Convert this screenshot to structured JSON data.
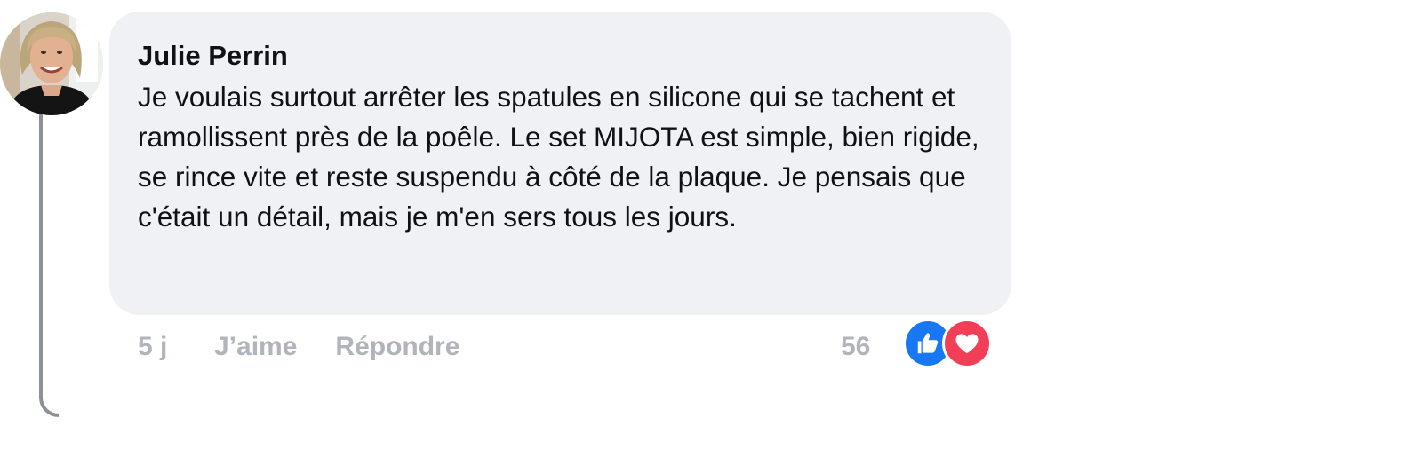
{
  "comment": {
    "author": "Julie Perrin",
    "text": "Je voulais surtout arrêter les spatules en silicone qui se tachent et ramollissent près de la poêle. Le set MIJOTA est simple, bien rigide, se rince vite et reste suspendu à côté de la plaque. Je pensais que c'était un détail, mais je m'en sers tous les jours."
  },
  "actions": {
    "time": "5 j",
    "like_label": "J’aime",
    "reply_label": "Répondre"
  },
  "reactions": {
    "count": "56",
    "types": [
      "like-icon",
      "heart-icon"
    ],
    "colors": {
      "like": "#1877f2",
      "love": "#f33e58"
    }
  },
  "colors": {
    "bubble": "#f0f1f5",
    "text": "#101114",
    "meta": "#b2b4bb",
    "thread_line": "#8d9096"
  }
}
